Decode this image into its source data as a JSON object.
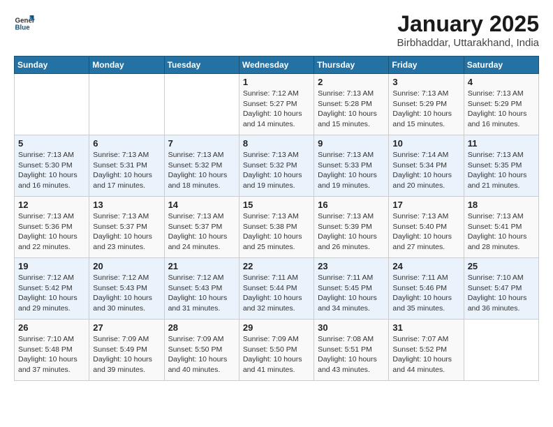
{
  "header": {
    "logo": {
      "general": "General",
      "blue": "Blue"
    },
    "title": "January 2025",
    "subtitle": "Birbhaddar, Uttarakhand, India"
  },
  "calendar": {
    "days_of_week": [
      "Sunday",
      "Monday",
      "Tuesday",
      "Wednesday",
      "Thursday",
      "Friday",
      "Saturday"
    ],
    "weeks": [
      [
        {
          "day": "",
          "info": ""
        },
        {
          "day": "",
          "info": ""
        },
        {
          "day": "",
          "info": ""
        },
        {
          "day": "1",
          "info": "Sunrise: 7:12 AM\nSunset: 5:27 PM\nDaylight: 10 hours\nand 14 minutes."
        },
        {
          "day": "2",
          "info": "Sunrise: 7:13 AM\nSunset: 5:28 PM\nDaylight: 10 hours\nand 15 minutes."
        },
        {
          "day": "3",
          "info": "Sunrise: 7:13 AM\nSunset: 5:29 PM\nDaylight: 10 hours\nand 15 minutes."
        },
        {
          "day": "4",
          "info": "Sunrise: 7:13 AM\nSunset: 5:29 PM\nDaylight: 10 hours\nand 16 minutes."
        }
      ],
      [
        {
          "day": "5",
          "info": "Sunrise: 7:13 AM\nSunset: 5:30 PM\nDaylight: 10 hours\nand 16 minutes."
        },
        {
          "day": "6",
          "info": "Sunrise: 7:13 AM\nSunset: 5:31 PM\nDaylight: 10 hours\nand 17 minutes."
        },
        {
          "day": "7",
          "info": "Sunrise: 7:13 AM\nSunset: 5:32 PM\nDaylight: 10 hours\nand 18 minutes."
        },
        {
          "day": "8",
          "info": "Sunrise: 7:13 AM\nSunset: 5:32 PM\nDaylight: 10 hours\nand 19 minutes."
        },
        {
          "day": "9",
          "info": "Sunrise: 7:13 AM\nSunset: 5:33 PM\nDaylight: 10 hours\nand 19 minutes."
        },
        {
          "day": "10",
          "info": "Sunrise: 7:14 AM\nSunset: 5:34 PM\nDaylight: 10 hours\nand 20 minutes."
        },
        {
          "day": "11",
          "info": "Sunrise: 7:13 AM\nSunset: 5:35 PM\nDaylight: 10 hours\nand 21 minutes."
        }
      ],
      [
        {
          "day": "12",
          "info": "Sunrise: 7:13 AM\nSunset: 5:36 PM\nDaylight: 10 hours\nand 22 minutes."
        },
        {
          "day": "13",
          "info": "Sunrise: 7:13 AM\nSunset: 5:37 PM\nDaylight: 10 hours\nand 23 minutes."
        },
        {
          "day": "14",
          "info": "Sunrise: 7:13 AM\nSunset: 5:37 PM\nDaylight: 10 hours\nand 24 minutes."
        },
        {
          "day": "15",
          "info": "Sunrise: 7:13 AM\nSunset: 5:38 PM\nDaylight: 10 hours\nand 25 minutes."
        },
        {
          "day": "16",
          "info": "Sunrise: 7:13 AM\nSunset: 5:39 PM\nDaylight: 10 hours\nand 26 minutes."
        },
        {
          "day": "17",
          "info": "Sunrise: 7:13 AM\nSunset: 5:40 PM\nDaylight: 10 hours\nand 27 minutes."
        },
        {
          "day": "18",
          "info": "Sunrise: 7:13 AM\nSunset: 5:41 PM\nDaylight: 10 hours\nand 28 minutes."
        }
      ],
      [
        {
          "day": "19",
          "info": "Sunrise: 7:12 AM\nSunset: 5:42 PM\nDaylight: 10 hours\nand 29 minutes."
        },
        {
          "day": "20",
          "info": "Sunrise: 7:12 AM\nSunset: 5:43 PM\nDaylight: 10 hours\nand 30 minutes."
        },
        {
          "day": "21",
          "info": "Sunrise: 7:12 AM\nSunset: 5:43 PM\nDaylight: 10 hours\nand 31 minutes."
        },
        {
          "day": "22",
          "info": "Sunrise: 7:11 AM\nSunset: 5:44 PM\nDaylight: 10 hours\nand 32 minutes."
        },
        {
          "day": "23",
          "info": "Sunrise: 7:11 AM\nSunset: 5:45 PM\nDaylight: 10 hours\nand 34 minutes."
        },
        {
          "day": "24",
          "info": "Sunrise: 7:11 AM\nSunset: 5:46 PM\nDaylight: 10 hours\nand 35 minutes."
        },
        {
          "day": "25",
          "info": "Sunrise: 7:10 AM\nSunset: 5:47 PM\nDaylight: 10 hours\nand 36 minutes."
        }
      ],
      [
        {
          "day": "26",
          "info": "Sunrise: 7:10 AM\nSunset: 5:48 PM\nDaylight: 10 hours\nand 37 minutes."
        },
        {
          "day": "27",
          "info": "Sunrise: 7:09 AM\nSunset: 5:49 PM\nDaylight: 10 hours\nand 39 minutes."
        },
        {
          "day": "28",
          "info": "Sunrise: 7:09 AM\nSunset: 5:50 PM\nDaylight: 10 hours\nand 40 minutes."
        },
        {
          "day": "29",
          "info": "Sunrise: 7:09 AM\nSunset: 5:50 PM\nDaylight: 10 hours\nand 41 minutes."
        },
        {
          "day": "30",
          "info": "Sunrise: 7:08 AM\nSunset: 5:51 PM\nDaylight: 10 hours\nand 43 minutes."
        },
        {
          "day": "31",
          "info": "Sunrise: 7:07 AM\nSunset: 5:52 PM\nDaylight: 10 hours\nand 44 minutes."
        },
        {
          "day": "",
          "info": ""
        }
      ]
    ]
  }
}
